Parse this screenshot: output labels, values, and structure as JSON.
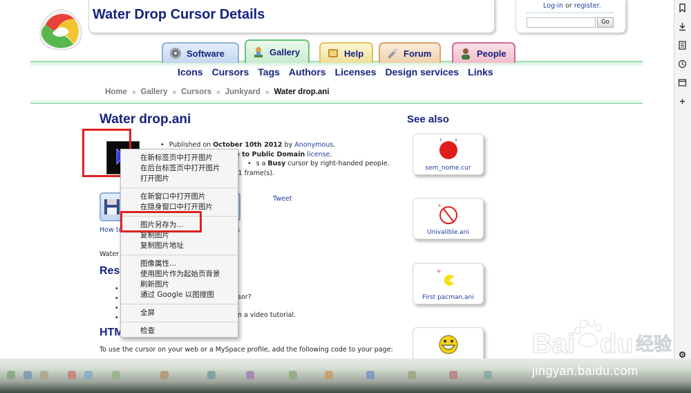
{
  "header": {
    "site_title": "Water Drop Cursor Details",
    "login_link": "Log-in",
    "login_or": " or ",
    "register_link": "register.",
    "go_label": "Go"
  },
  "tabs": [
    {
      "label": "Software",
      "icon": "disc-icon"
    },
    {
      "label": "Gallery",
      "icon": "gallery-icon"
    },
    {
      "label": "Help",
      "icon": "help-icon"
    },
    {
      "label": "Forum",
      "icon": "forum-icon"
    },
    {
      "label": "People",
      "icon": "people-icon"
    }
  ],
  "nav": [
    "Icons",
    "Cursors",
    "Tags",
    "Authors",
    "Licenses",
    "Design services",
    "Links"
  ],
  "breadcrumb": [
    "Home",
    "Gallery",
    "Cursors",
    "Junkyard",
    "Water drop.ani"
  ],
  "content": {
    "heading": "Water drop.ani",
    "meta_published_prefix": "Published on ",
    "meta_date": "October 10th 2012",
    "meta_by": " by ",
    "meta_author": "Anonymous",
    "meta_line2_bold": "lease to Public Domain",
    "meta_line2_link": " license",
    "meta_line3_prefix": "s a ",
    "meta_line3_bold": "Busy",
    "meta_line3_suffix": " cursor by right-handed people.",
    "meta_line4": "1 frame(s).",
    "tweet": "Tweet",
    "how_label": "How to d",
    "how_label_right": "s",
    "water_text": "Water drop",
    "resources_heading": "Resou",
    "res_items": [
      "W",
      "Ho",
      "Dr",
      "Le"
    ],
    "res_right_1": "sor?",
    "res_right_2": "n a video tutorial.",
    "html_heading": "HTML",
    "use_text": "To use the cursor on your web or a MySpace profile, add the following code to your page:"
  },
  "see_also": {
    "heading": "See also",
    "items": [
      "sem_nome.cur",
      "Univalible.ani",
      "First pacman.ani",
      ""
    ]
  },
  "context_menu": {
    "group1": [
      "在新标签页中打开图片",
      "在后台标签页中打开图片",
      "打开图片"
    ],
    "group2": [
      "在新窗口中打开图片",
      "在隐身窗口中打开图片"
    ],
    "group3": [
      "图片另存为...",
      "复制图片",
      "复制图片地址"
    ],
    "group4": [
      "图像属性...",
      "使用图片作为起始页背景",
      "刷新图片",
      "通过 Google 以图搜图"
    ],
    "group5": [
      "全屏"
    ],
    "group6": [
      "检查"
    ]
  },
  "watermark": {
    "brand": "Bai 经验",
    "url": "jingyan.baidu.com"
  },
  "colors": {
    "title_blue": "#15237f",
    "link_blue": "#1c3d9e",
    "nav_green": "#7ecf90",
    "highlight_red": "#e02020"
  }
}
